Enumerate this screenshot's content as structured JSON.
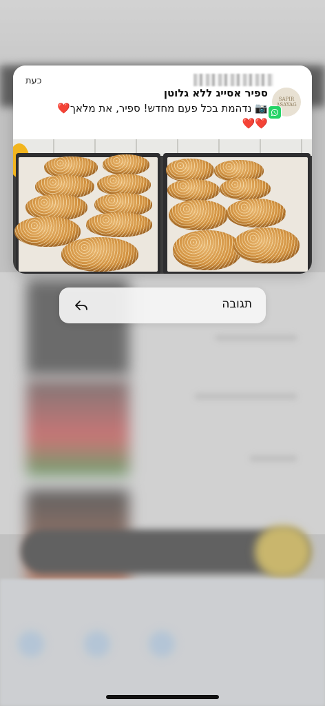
{
  "notification": {
    "time": "כעת",
    "sender": "ספיר אסייג ללא גלוטן",
    "message_line1": "📷 נדהמת בכל פעם מחדש! ספיר, את מלאך❤️",
    "message_line2": "❤️❤️",
    "app_icon_text_top": "SAPIR",
    "app_icon_text_bottom": "ASAYAG",
    "source_app": "whatsapp-icon"
  },
  "photo": {
    "subject": "challah-breads-on-baking-trays"
  },
  "actions": {
    "reply_label": "תגובה"
  },
  "colors": {
    "whatsapp_green": "#25d366",
    "card_bg": "#ffffff"
  }
}
